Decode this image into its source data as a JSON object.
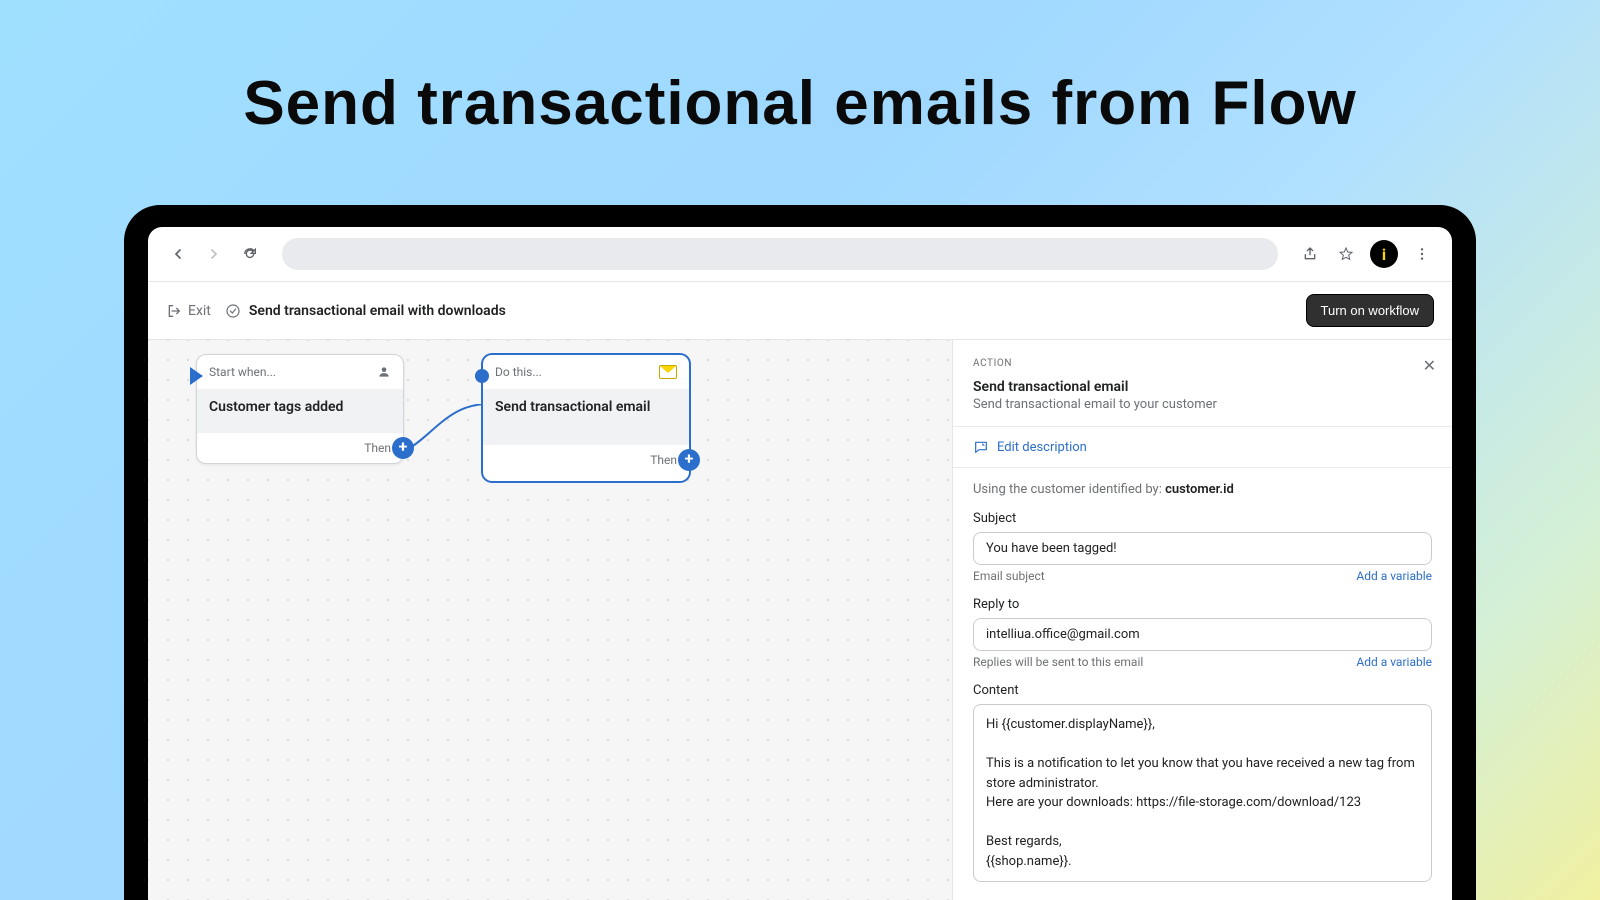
{
  "hero": {
    "title": "Send transactional emails from Flow"
  },
  "header": {
    "exit": "Exit",
    "workflow_title": "Send transactional email with downloads",
    "turn_on": "Turn on workflow"
  },
  "canvas": {
    "trigger": {
      "prefix": "Start when...",
      "title": "Customer tags added",
      "then": "Then"
    },
    "action": {
      "prefix": "Do this...",
      "title": "Send transactional email",
      "then": "Then"
    }
  },
  "panel": {
    "section_label": "ACTION",
    "title": "Send transactional email",
    "subtitle": "Send transactional email to your customer",
    "edit_description": "Edit description",
    "identified_prefix": "Using the customer identified by: ",
    "identified_value": "customer.id",
    "subject": {
      "label": "Subject",
      "value": "You have been tagged!",
      "help": "Email subject",
      "add_variable": "Add a variable"
    },
    "reply_to": {
      "label": "Reply to",
      "value": "intelliua.office@gmail.com",
      "help": "Replies will be sent to this email",
      "add_variable": "Add a variable"
    },
    "content": {
      "label": "Content",
      "value": "Hi {{customer.displayName}},\n\nThis is a notification to let you know that you have received a new tag from store administrator.\nHere are your downloads: https://file-storage.com/download/123\n\nBest regards,\n{{shop.name}}."
    }
  },
  "avatar_letter": "i"
}
